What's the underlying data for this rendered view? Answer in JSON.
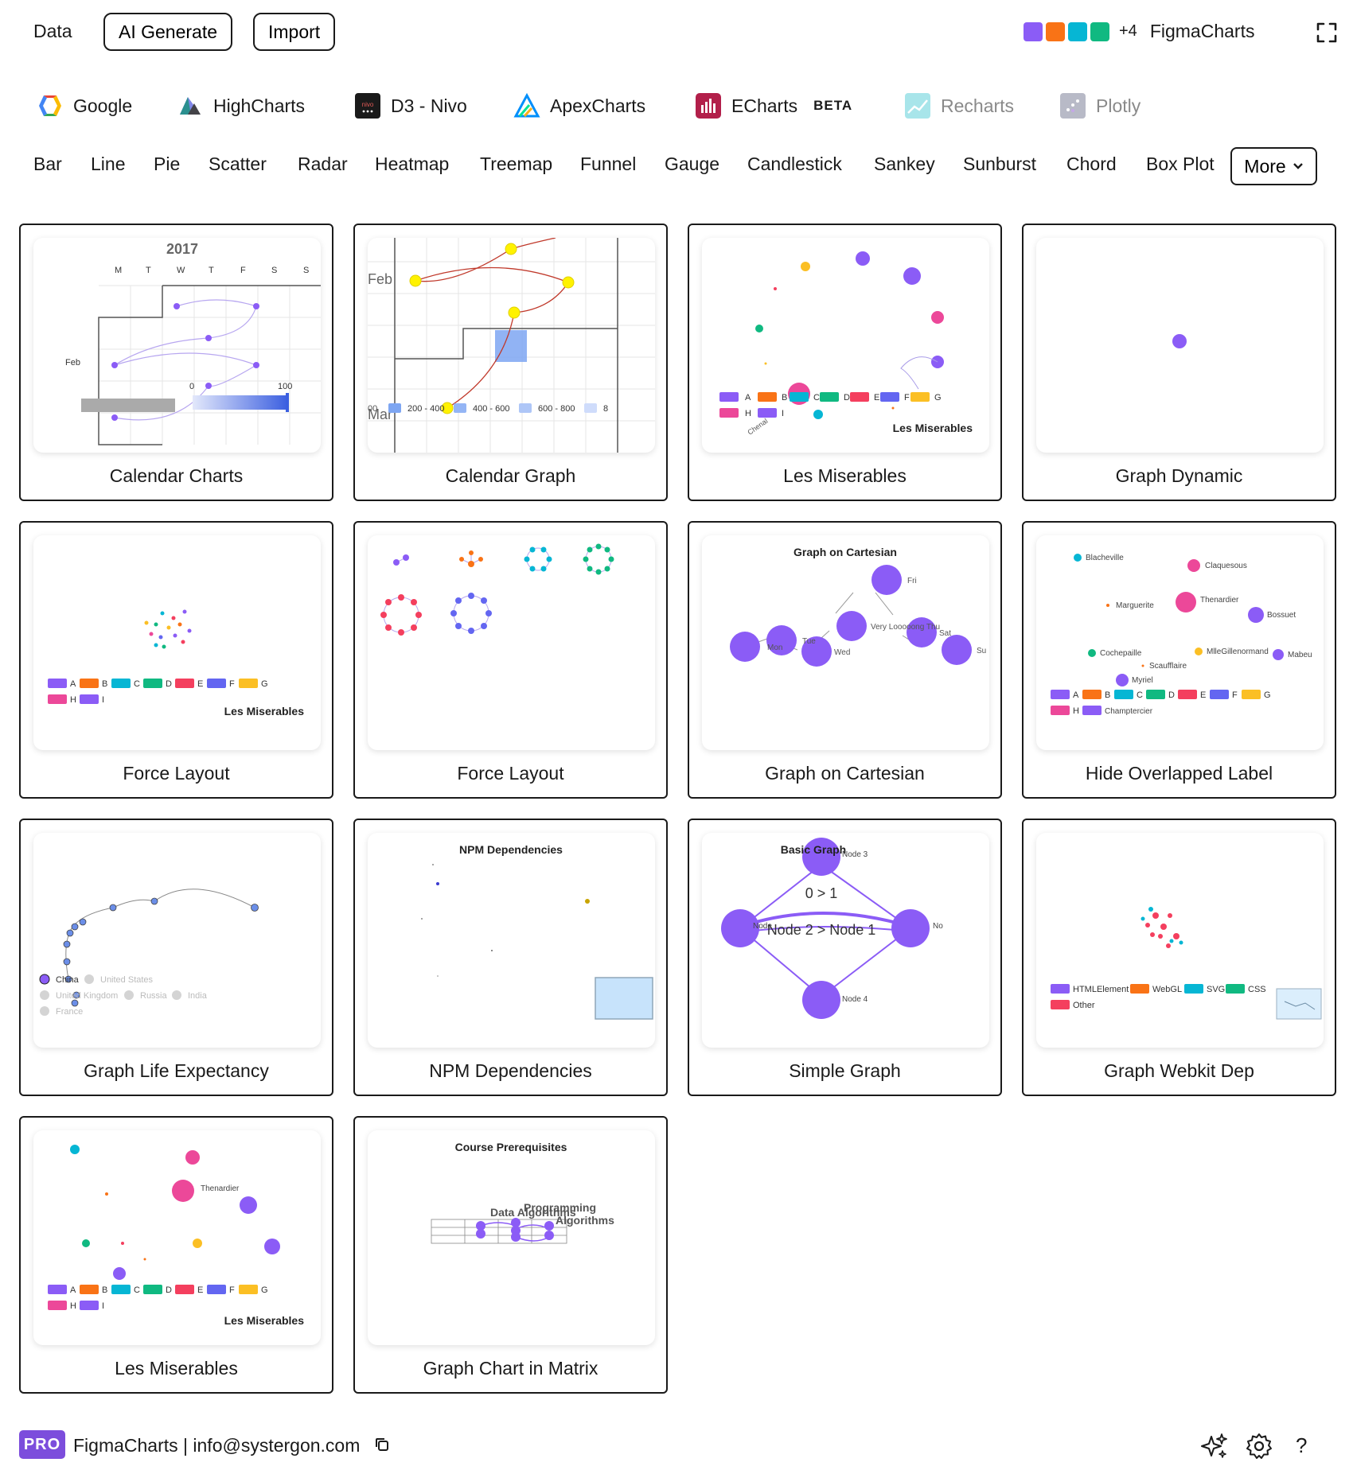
{
  "header": {
    "data_label": "Data",
    "ai_generate_label": "AI Generate",
    "import_label": "Import",
    "brand_swatches": [
      "#8b5cf6",
      "#f97316",
      "#06b6d4",
      "#10b981"
    ],
    "brand_extra": "+4",
    "brand_name": "FigmaCharts"
  },
  "libraries": [
    {
      "name": "Google"
    },
    {
      "name": "HighCharts"
    },
    {
      "name": "D3 - Nivo"
    },
    {
      "name": "ApexCharts"
    },
    {
      "name": "ECharts",
      "badge": "BETA"
    },
    {
      "name": "Recharts"
    },
    {
      "name": "Plotly"
    }
  ],
  "chart_types": [
    "Bar",
    "Line",
    "Pie",
    "Scatter",
    "Radar",
    "Heatmap",
    "Treemap",
    "Funnel",
    "Gauge",
    "Candlestick",
    "Sankey",
    "Sunburst",
    "Chord",
    "Box Plot"
  ],
  "more_label": "More",
  "palette": {
    "A": "#8b5cf6",
    "B": "#f97316",
    "C": "#06b6d4",
    "D": "#10b981",
    "E": "#f43f5e",
    "F": "#6366f1",
    "G": "#fbbf24",
    "H": "#ec4899",
    "I": "#8b5cf6"
  },
  "cards": [
    {
      "title": "Calendar Charts",
      "preview": {
        "year": "2017",
        "days": [
          "M",
          "T",
          "W",
          "T",
          "F",
          "S",
          "S"
        ],
        "month": "Feb",
        "range_min": "0",
        "range_max": "100"
      }
    },
    {
      "title": "Calendar Graph",
      "preview": {
        "month1": "Feb",
        "month2": "Mar",
        "legend": [
          "200 - 400",
          "400 - 600",
          "600 - 800",
          "8"
        ],
        "start_tick": "00"
      }
    },
    {
      "title": "Les Miserables",
      "preview": {
        "legend": [
          "A",
          "B",
          "C",
          "D",
          "E",
          "F",
          "G",
          "H",
          "I"
        ],
        "caption": "Les Miserables",
        "node_label": "Chenal"
      }
    },
    {
      "title": "Graph Dynamic"
    },
    {
      "title": "Force Layout",
      "preview": {
        "legend": [
          "A",
          "B",
          "C",
          "D",
          "E",
          "F",
          "G",
          "H",
          "I"
        ],
        "caption": "Les Miserables"
      }
    },
    {
      "title": "Force Layout"
    },
    {
      "title": "Graph on Cartesian",
      "preview": {
        "heading": "Graph on Cartesian",
        "nodes": [
          "Mon",
          "Tue",
          "Wed",
          "Very Looooong Thu",
          "Fri",
          "Sat",
          "Su"
        ]
      }
    },
    {
      "title": "Hide Overlapped Label",
      "preview": {
        "names": [
          "Blacheville",
          "Claquesous",
          "Marguerite",
          "Thenardier",
          "Bossuet",
          "Cochepaille",
          "MlleGillenormand",
          "Mabeu",
          "Scaufflaire",
          "Myriel",
          "Champtercier"
        ],
        "legend": [
          "A",
          "B",
          "C",
          "D",
          "E",
          "F",
          "G",
          "H"
        ]
      }
    },
    {
      "title": "Graph Life Expectancy",
      "preview": {
        "countries": [
          "China",
          "United States",
          "United Kingdom",
          "Russia",
          "India",
          "France"
        ]
      }
    },
    {
      "title": "NPM Dependencies",
      "preview": {
        "heading": "NPM Dependencies"
      }
    },
    {
      "title": "Simple Graph",
      "preview": {
        "heading": "Basic Graph",
        "node3": "Node 3",
        "node4": "Node 4",
        "node": "Node",
        "node_right": "No",
        "edge1": "0 > 1",
        "edge2": "Node 2 > Node 1"
      }
    },
    {
      "title": "Graph Webkit Dep",
      "preview": {
        "legend": [
          "HTMLElement",
          "WebGL",
          "SVG",
          "CSS",
          "Other"
        ]
      }
    },
    {
      "title": "Les Miserables",
      "preview": {
        "legend": [
          "A",
          "B",
          "C",
          "D",
          "E",
          "F",
          "G",
          "H",
          "I"
        ],
        "caption": "Les Miserables",
        "node_label": "Thenardier"
      }
    },
    {
      "title": "Graph Chart in Matrix",
      "preview": {
        "heading": "Course Prerequisites",
        "labels": [
          "Programming",
          "Data Algorithms",
          "Algorithms"
        ]
      }
    }
  ],
  "footer": {
    "badge": "PRO",
    "text": "FigmaCharts | info@systergon.com",
    "help": "?"
  }
}
